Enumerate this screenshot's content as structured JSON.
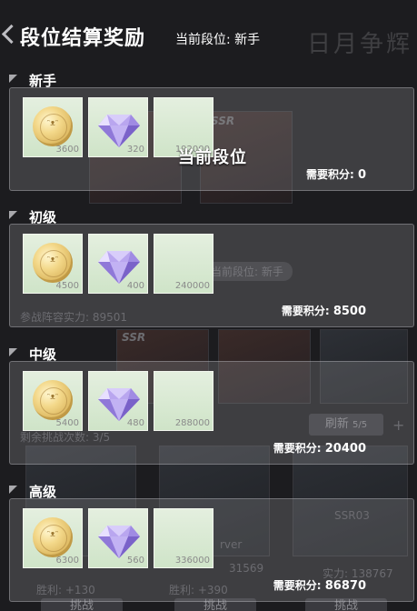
{
  "header": {
    "title": "段位结算奖励",
    "current_rank": "当前段位: 新手",
    "bg_watermark": "日月争辉"
  },
  "background": {
    "card_tag_1": "SSR",
    "card_tag_2": "SSR",
    "rank_pill": "当前段位: 新手",
    "power_text": "参战阵容实力: 89501",
    "refresh_btn": "刷新",
    "refresh_count": "5/5",
    "plus": "+",
    "remaining_text": "剩余挑战次数: 3/5",
    "name_3": "rver",
    "wins_1": "胜利: +130",
    "wins_2": "胜利: +390",
    "power_3": "实力: 138767",
    "id_2": "31569",
    "id_3": "SSR03",
    "challenge_1": "挑战",
    "challenge_2": "挑战",
    "challenge_3": "挑战"
  },
  "requirement_label": "需要积分:",
  "current_tier_label": "当前段位",
  "tiers": [
    {
      "name": "新手",
      "coin": "3600",
      "gem": "320",
      "third": "192000",
      "points": "0",
      "is_current": true
    },
    {
      "name": "初级",
      "coin": "4500",
      "gem": "400",
      "third": "240000",
      "points": "8500",
      "is_current": false
    },
    {
      "name": "中级",
      "coin": "5400",
      "gem": "480",
      "third": "288000",
      "points": "20400",
      "is_current": false
    },
    {
      "name": "高级",
      "coin": "6300",
      "gem": "560",
      "third": "336000",
      "points": "86870",
      "is_current": false
    }
  ],
  "colors": {
    "panel_bg": "#96969b",
    "reward_bg": "#dbe9d5",
    "text": "#ffffff"
  },
  "icons": {
    "coin": "coin-icon",
    "gem": "diamond-icon",
    "back": "back-arrow-icon"
  }
}
